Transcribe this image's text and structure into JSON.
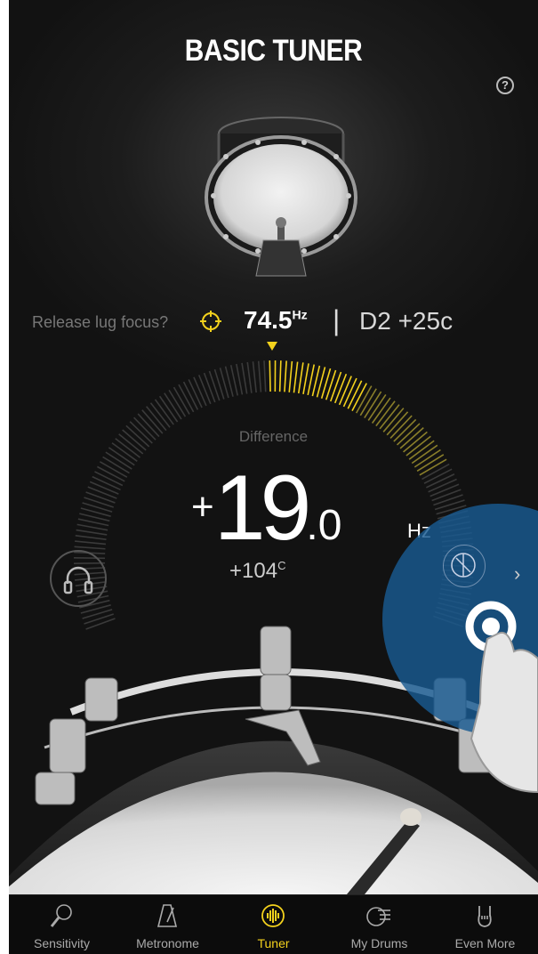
{
  "header": {
    "title": "BASIC TUNER",
    "help_icon": "question-circle-icon"
  },
  "readout": {
    "release_label": "Release lug focus?",
    "focus_icon": "crosshair-icon",
    "frequency": "74.5",
    "frequency_unit": "Hz",
    "separator": "|",
    "note": "D2 +25c"
  },
  "dial": {
    "difference_label": "Difference",
    "sign": "+",
    "integer": "19",
    "decimal": ".0",
    "unit": "Hz",
    "cents": "+104",
    "cents_unit": "C"
  },
  "controls": {
    "headphones_icon": "headphones-icon",
    "lug_icon": "drum-lug-icon",
    "chevron": "›"
  },
  "colors": {
    "accent": "#f4d21d",
    "overlay": "#185a91",
    "background": "#161616"
  },
  "tabs": [
    {
      "label": "Sensitivity",
      "icon": "microphone-icon",
      "active": false
    },
    {
      "label": "Metronome",
      "icon": "metronome-icon",
      "active": false
    },
    {
      "label": "Tuner",
      "icon": "tuner-icon",
      "active": true
    },
    {
      "label": "My Drums",
      "icon": "drum-list-icon",
      "active": false
    },
    {
      "label": "Even More",
      "icon": "rock-hand-icon",
      "active": false
    }
  ]
}
